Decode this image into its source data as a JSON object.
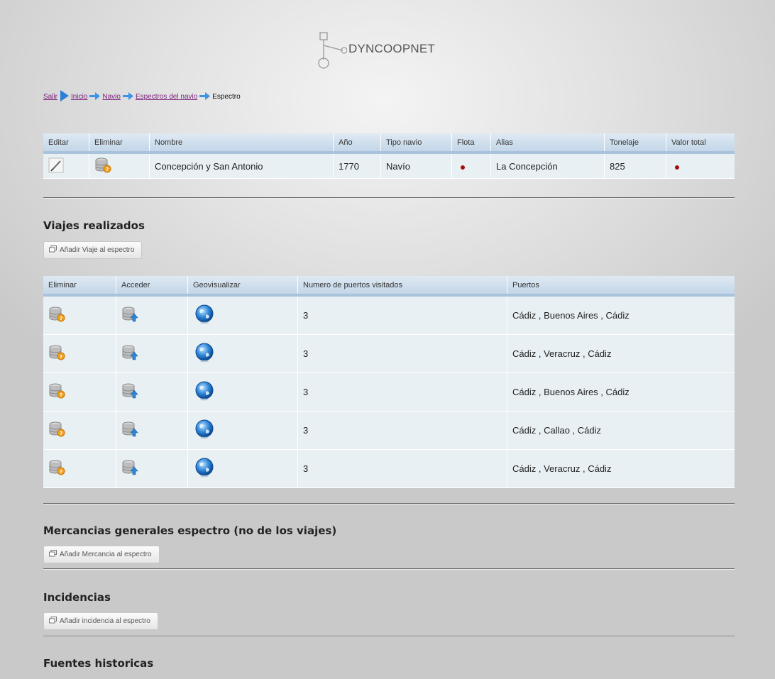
{
  "logo": {
    "text": "DYNCOOPNET"
  },
  "breadcrumb": {
    "salir": "Salir",
    "inicio": "Inicio",
    "navio": "Navio",
    "espectros": "Espectros del navio",
    "current": "Espectro"
  },
  "ship_table": {
    "headers": [
      "Editar",
      "Eliminar",
      "Nombre",
      "Año",
      "Tipo navio",
      "Flota",
      "Alias",
      "Tonelaje",
      "Valor total"
    ],
    "row": {
      "edit_icon": "pencil-icon",
      "delete_icon": "database-delete-icon",
      "nombre": "Concepción y San Antonio",
      "anio": "1770",
      "tipo": "Navío",
      "flota_icon": "red-dot",
      "alias": "La Concepción",
      "tonelaje": "825",
      "valor_icon": "red-dot"
    }
  },
  "viajes": {
    "title": "Viajes realizados",
    "add_button": "Añadir Viaje al espectro",
    "headers": [
      "Eliminar",
      "Acceder",
      "Geovisualizar",
      "Numero de puertos visitados",
      "Puertos"
    ],
    "rows": [
      {
        "num_puertos": "3",
        "puertos": "Cádiz , Buenos Aires , Cádiz"
      },
      {
        "num_puertos": "3",
        "puertos": "Cádiz , Veracruz , Cádiz"
      },
      {
        "num_puertos": "3",
        "puertos": "Cádiz , Buenos Aires , Cádiz"
      },
      {
        "num_puertos": "3",
        "puertos": "Cádiz , Callao , Cádiz"
      },
      {
        "num_puertos": "3",
        "puertos": "Cádiz , Veracruz , Cádiz"
      }
    ]
  },
  "mercancias": {
    "title": "Mercancias generales espectro (no de los viajes)",
    "add_button": "Añadir Mercancia al espectro"
  },
  "incidencias": {
    "title": "Incidencias",
    "add_button": "Añadir incidencia al espectro"
  },
  "fuentes": {
    "title": "Fuentes historicas"
  },
  "colors": {
    "link": "#7b1f7b",
    "header_blue": "#c3d6e8",
    "row_bg": "#e8f0f4",
    "dot_red": "#a30e0e"
  }
}
